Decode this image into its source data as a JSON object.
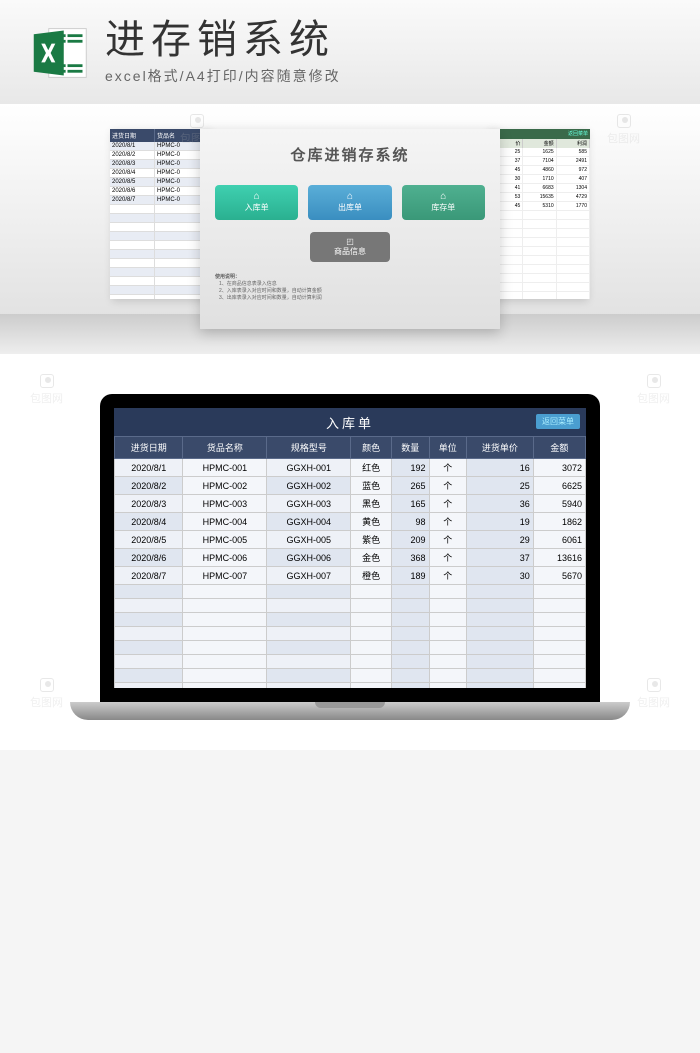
{
  "header": {
    "title": "进存销系统",
    "subtitle": "excel格式/A4打印/内容随意修改"
  },
  "menu": {
    "title": "仓库进销存系统",
    "btn_in": "入库单",
    "btn_out": "出库单",
    "btn_stock": "库存单",
    "btn_info": "商品信息",
    "usage_title": "使用说明：",
    "usage_1": "1、在商品信息表录入信息",
    "usage_2": "2、入库表录入对应时间和数量，自动计算金额",
    "usage_3": "3、出库表录入对应时间和数量，自动计算利润"
  },
  "left_panel": {
    "col1": "进货日期",
    "col2": "货品名",
    "rows": [
      {
        "d": "2020/8/1",
        "n": "HPMC-0"
      },
      {
        "d": "2020/8/2",
        "n": "HPMC-0"
      },
      {
        "d": "2020/8/3",
        "n": "HPMC-0"
      },
      {
        "d": "2020/8/4",
        "n": "HPMC-0"
      },
      {
        "d": "2020/8/5",
        "n": "HPMC-0"
      },
      {
        "d": "2020/8/6",
        "n": "HPMC-0"
      },
      {
        "d": "2020/8/7",
        "n": "HPMC-0"
      }
    ]
  },
  "right_panel": {
    "back": "返回菜单",
    "col1": "价",
    "col2": "金额",
    "col3": "利润",
    "rows": [
      {
        "a": "25",
        "b": "1625",
        "c": "585"
      },
      {
        "a": "37",
        "b": "7104",
        "c": "2491"
      },
      {
        "a": "45",
        "b": "4860",
        "c": "972"
      },
      {
        "a": "30",
        "b": "1710",
        "c": "407"
      },
      {
        "a": "41",
        "b": "6683",
        "c": "1304"
      },
      {
        "a": "53",
        "b": "15635",
        "c": "4729"
      },
      {
        "a": "45",
        "b": "5310",
        "c": "1770"
      }
    ]
  },
  "sheet": {
    "title": "入库单",
    "back": "返回菜单",
    "headers": [
      "进货日期",
      "货品名称",
      "规格型号",
      "颜色",
      "数量",
      "单位",
      "进货单价",
      "金额"
    ],
    "rows": [
      {
        "date": "2020/8/1",
        "name": "HPMC-001",
        "spec": "GGXH-001",
        "color": "红色",
        "qty": "192",
        "unit": "个",
        "price": "16",
        "amount": "3072"
      },
      {
        "date": "2020/8/2",
        "name": "HPMC-002",
        "spec": "GGXH-002",
        "color": "蓝色",
        "qty": "265",
        "unit": "个",
        "price": "25",
        "amount": "6625"
      },
      {
        "date": "2020/8/3",
        "name": "HPMC-003",
        "spec": "GGXH-003",
        "color": "黑色",
        "qty": "165",
        "unit": "个",
        "price": "36",
        "amount": "5940"
      },
      {
        "date": "2020/8/4",
        "name": "HPMC-004",
        "spec": "GGXH-004",
        "color": "黄色",
        "qty": "98",
        "unit": "个",
        "price": "19",
        "amount": "1862"
      },
      {
        "date": "2020/8/5",
        "name": "HPMC-005",
        "spec": "GGXH-005",
        "color": "紫色",
        "qty": "209",
        "unit": "个",
        "price": "29",
        "amount": "6061"
      },
      {
        "date": "2020/8/6",
        "name": "HPMC-006",
        "spec": "GGXH-006",
        "color": "金色",
        "qty": "368",
        "unit": "个",
        "price": "37",
        "amount": "13616"
      },
      {
        "date": "2020/8/7",
        "name": "HPMC-007",
        "spec": "GGXH-007",
        "color": "橙色",
        "qty": "189",
        "unit": "个",
        "price": "30",
        "amount": "5670"
      }
    ]
  },
  "watermark": "包图网"
}
